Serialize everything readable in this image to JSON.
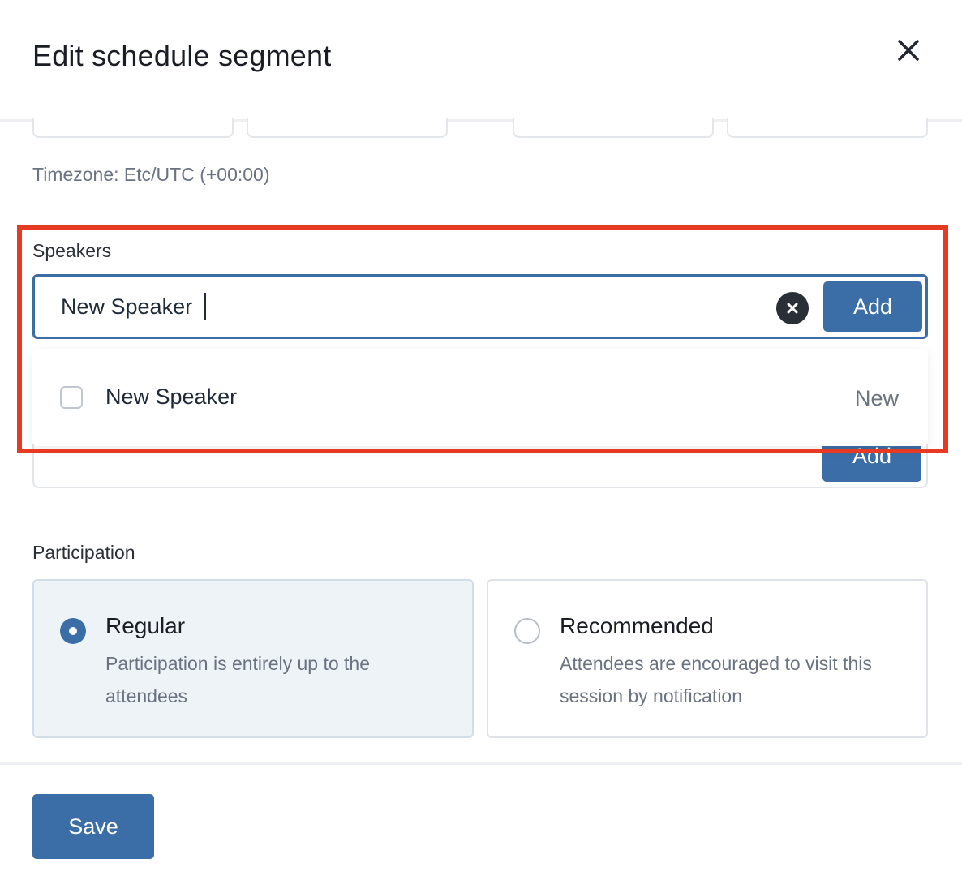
{
  "modal": {
    "title": "Edit schedule segment"
  },
  "schedule": {
    "timezone": "Timezone: Etc/UTC (+00:00)"
  },
  "speakers": {
    "label": "Speakers",
    "input_value": "New Speaker",
    "add_label": "Add",
    "suggestion": {
      "label": "New Speaker",
      "tag": "New",
      "checked": false
    }
  },
  "participation": {
    "label": "Participation",
    "options": [
      {
        "title": "Regular",
        "description": "Participation is entirely up to the attendees",
        "selected": true
      },
      {
        "title": "Recommended",
        "description": "Attendees are encouraged to visit this session by notification",
        "selected": false
      }
    ]
  },
  "footer": {
    "save_label": "Save"
  },
  "colors": {
    "accent": "#3b6ea6",
    "highlight": "#e63a22",
    "selected_card_bg": "#eef3f8",
    "muted_text": "#6b7280"
  },
  "icons": {
    "close": "close-icon",
    "clear": "clear-icon"
  }
}
